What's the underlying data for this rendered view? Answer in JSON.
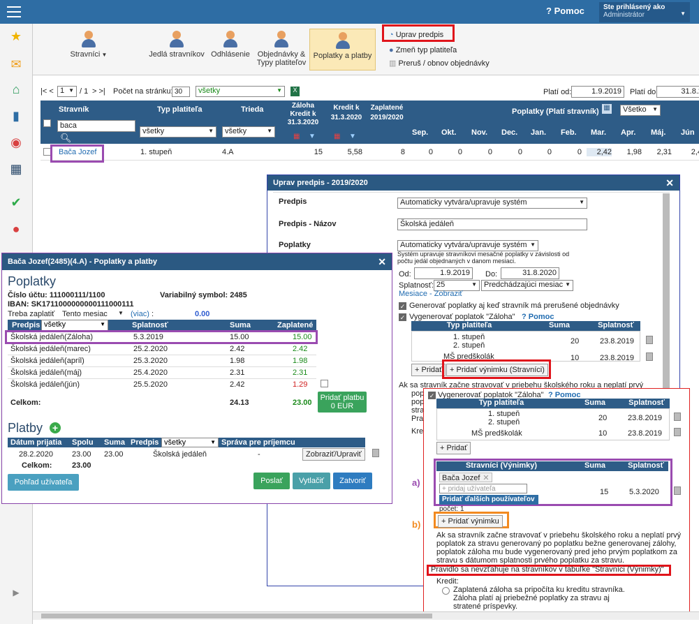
{
  "topbar": {
    "help": "Pomoc",
    "logged": "Ste prihlásený ako",
    "role": "Administrátor"
  },
  "toolbar": {
    "stravnici": "Stravníci",
    "jedla": "Jedlá stravníkov",
    "odhlasenie": "Odhlásenie",
    "objednavky": "Objednávky & Typy platiteľov",
    "poplatky": "Poplatky a platby",
    "uprav": "Uprav predpis",
    "zmen": "Zmeň typ platiteľa",
    "prerus": "Preruš / obnov objednávky"
  },
  "pager": {
    "nav": "|< <",
    "page": "1",
    "of": "/ 1",
    "next": "> >|",
    "perpage_label": "Počet na stránku:",
    "perpage": "30",
    "filter": "všetky",
    "plati_od_label": "Platí od:",
    "plati_od": "1.9.2019",
    "plati_do_label": "Platí do:",
    "plati_do": "31.8.2"
  },
  "grid": {
    "h_stravnik": "Stravník",
    "h_typ": "Typ platiteľa",
    "h_trieda": "Trieda",
    "h_zaloha": "Záloha Kredit k 31.3.2020",
    "h_kredit": "Kredit k 31.3.2020",
    "h_zaplatene": "Zaplatené 2019/2020",
    "h_poplatky": "Poplatky (Platí stravník)",
    "h_vsetko": "Všetko",
    "search": "baca",
    "typ_filter": "všetky",
    "trieda_filter": "všetky",
    "months": [
      "Sep.",
      "Okt.",
      "Nov.",
      "Dec.",
      "Jan.",
      "Feb.",
      "Mar.",
      "Apr.",
      "Máj.",
      "Jún"
    ],
    "row": {
      "name": "Bača Jozef",
      "typ": "1. stupeň",
      "trieda": "4.A",
      "zaloha": "15",
      "kredit": "5,58",
      "zaplatene": "8",
      "vals": [
        "0",
        "0",
        "0",
        "0",
        "0",
        "0",
        "2,42",
        "1,98",
        "2,31",
        "2,4"
      ]
    }
  },
  "upd": {
    "title": "Uprav predpis - 2019/2020",
    "predpis_l": "Predpis",
    "predpis": "Automaticky vytvára/upravuje systém",
    "nazov_l": "Predpis - Názov",
    "nazov": "Školská jedáleň",
    "poplatky_l": "Poplatky",
    "poplatky": "Automaticky vytvára/upravuje systém",
    "note": "Systém upravuje stravníkovi mesačné poplatky v závislosti od počtu jedál objednaných v danom mesiaci.",
    "od_l": "Od:",
    "od": "1.9.2019",
    "do_l": "Do:",
    "do": "31.8.2020",
    "splat_l": "Splatnosť:",
    "splat": "25",
    "splat2": "Predchádzajúci mesiac",
    "mesiace": "Mesiace - Zobraziť",
    "gen1": "Generovať poplatky aj keď stravník má prerušené objednávky",
    "gen2": "Vygenerovať poplatok \"Záloha\"",
    "pomoc": "? Pomoc",
    "th_typ": "Typ platiteľa",
    "th_suma": "Suma",
    "th_splat": "Splatnosť",
    "r1a": "1. stupeň",
    "r1b": "2. stupeň",
    "r1s": "20",
    "r1d": "23.8.2019",
    "r2a": "MŠ predškolák",
    "r2s": "10",
    "r2d": "23.8.2019",
    "pridat": "+ Pridať",
    "pridat_vynimku": "+ Pridať výnimku (Stravníci)",
    "ak1": "Ak sa stravník začne stravovať v priebehu školského roku a neplatí prvý",
    "frag1": "pop",
    "frag2": "pop",
    "frag3": "stra",
    "frag4": "Prav",
    "frag5": "Kred"
  },
  "pp": {
    "title": "Bača Jozef(2485)(4.A) - Poplatky a platby",
    "poplatky": "Poplatky",
    "ucet_l": "Číslo účtu: 111000111/1100",
    "vs_l": "Variabilný symbol: 2485",
    "iban": "IBAN: SK1711000000000111000111",
    "treba": "Treba zaplatiť",
    "tento": "Tento mesiac",
    "viac": "(viac)",
    "colon": ":",
    "treba_val": "0.00",
    "h_predpis": "Predpis",
    "h_filter": "všetky",
    "h_splat": "Splatnosť",
    "h_suma": "Suma",
    "h_zapl": "Zaplatené",
    "rows": [
      {
        "n": "Školská jedáleň(Záloha)",
        "d": "5.3.2019",
        "s": "15.00",
        "z": "15.00",
        "c": "#1a8a1a"
      },
      {
        "n": "Školská jedáleň(marec)",
        "d": "25.2.2020",
        "s": "2.42",
        "z": "2.42",
        "c": "#1a8a1a"
      },
      {
        "n": "Školská jedáleň(apríl)",
        "d": "25.3.2020",
        "s": "1.98",
        "z": "1.98",
        "c": "#1a8a1a"
      },
      {
        "n": "Školská jedáleň(máj)",
        "d": "25.4.2020",
        "s": "2.31",
        "z": "2.31",
        "c": "#1a8a1a"
      },
      {
        "n": "Školská jedáleň(jún)",
        "d": "25.5.2020",
        "s": "2.42",
        "z": "1.29",
        "c": "#d02020"
      }
    ],
    "celkom": "Celkom:",
    "c_suma": "24.13",
    "c_zapl": "23.00",
    "pridat_platbu": "Pridať platbu",
    "eur": "0 EUR",
    "platby": "Platby",
    "ph_datum": "Dátum prijatia",
    "ph_spolu": "Spolu",
    "ph_suma": "Suma",
    "ph_predpis": "Predpis",
    "ph_filter": "všetky",
    "ph_sprava": "Správa pre príjemcu",
    "pr_datum": "28.2.2020",
    "pr_spolu": "23.00",
    "pr_suma": "23.00",
    "pr_predpis": "Školská jedáleň",
    "pr_sprava": "-",
    "zobrazit": "Zobraziť/Upraviť",
    "celkom2": "Celkom:",
    "celkom2_val": "23.00",
    "pohlad": "Pohľad užívateľa",
    "poslat": "Poslať",
    "vytlacit": "Vytlačiť",
    "zatvorit": "Zatvoriť"
  },
  "zoom": {
    "gen2": "Vygenerovať poplatok \"Záloha\"",
    "pomoc": "? Pomoc",
    "th_typ": "Typ platiteľa",
    "th_suma": "Suma",
    "th_splat": "Splatnosť",
    "r1a": "1. stupeň",
    "r1b": "2. stupeň",
    "r1s": "20",
    "r1d": "23.8.2019",
    "r2a": "MŠ predškolák",
    "r2s": "10",
    "r2d": "23.8.2019",
    "pridat": "+ Pridať",
    "vh_str": "Stravníci (Výnimky)",
    "vh_suma": "Suma",
    "vh_splat": "Splatnosť",
    "tag": "Bača Jozef",
    "placeholder": "+ pridaj užívateľa",
    "pridat_dalsich": "Pridať ďalších používateľov",
    "pocet": "počet: 1",
    "v_suma": "15",
    "v_splat": "5.3.2020",
    "pridat_vynimku": "+ Pridať výnimku",
    "desc": "Ak sa stravník začne stravovať v priebehu školského roku a neplatí prvý poplatok za stravu generovaný po poplatku bežne generovanej zálohy, poplatok záloha mu bude vygenerovaný pred jeho prvým poplatkom za stravu s dátumom splatnosti prvého poplatku za stravu.",
    "pravidlo": "Pravidlo sa nevzťahuje na stravníkov v tabuľke \"Stravníci (Výnimky)\"",
    "kredit": "Kredit:",
    "k1": "Zaplatená záloha sa pripočíta ku kreditu stravníka.",
    "k2": "Záloha platí aj priebežné poplatky za stravu aj stratené príspevky."
  },
  "labels": {
    "a": "a)",
    "b": "b)"
  }
}
